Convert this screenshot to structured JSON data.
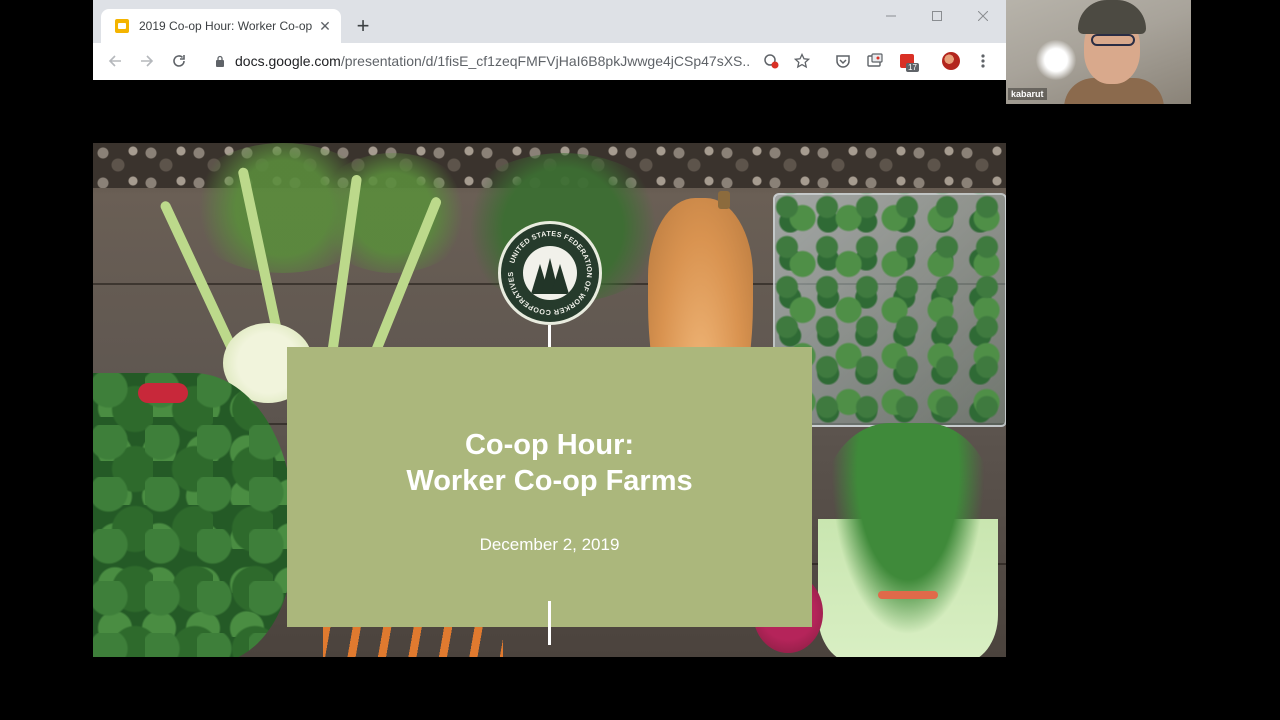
{
  "browser": {
    "tab_title": "2019 Co-op Hour: Worker Co-op",
    "url_host": "docs.google.com",
    "url_path": "/presentation/d/1fisE_cf1zeqFMFVjHaI6B8pkJwwge4jCSp47sXS...",
    "extension_badge": "17"
  },
  "slide": {
    "logo_text": "UNITED STATES FEDERATION OF WORKER COOPERATIVES",
    "title_line1": "Co-op Hour:",
    "title_line2": "Worker Co-op Farms",
    "date": "December 2, 2019",
    "box_color": "#abb77c"
  },
  "webcam": {
    "participant_name": "kabarut"
  }
}
